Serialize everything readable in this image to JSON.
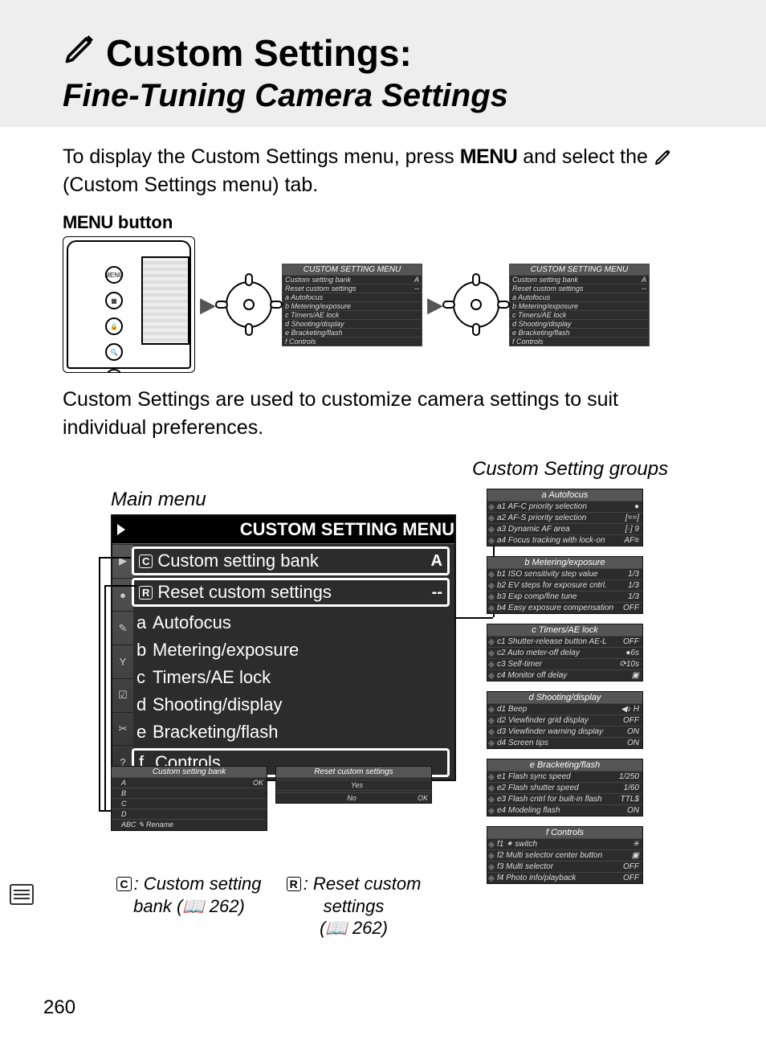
{
  "header": {
    "title_line1": "Custom Settings:",
    "title_line2": "Fine-Tuning Camera Settings"
  },
  "intro": {
    "pre": "To display the Custom Settings menu, press ",
    "menu_word": "MENU",
    "mid": " and select the ",
    "post": " (Custom Settings menu) tab."
  },
  "menu_button_caption": {
    "menu": "MENU",
    "button": " button"
  },
  "mini_menu_title": "CUSTOM SETTING MENU",
  "mini_menu_items": [
    {
      "l": "",
      "t": "Custom setting bank",
      "r": "A"
    },
    {
      "l": "",
      "t": "Reset custom settings",
      "r": "--"
    },
    {
      "l": "a",
      "t": "Autofocus",
      "r": ""
    },
    {
      "l": "b",
      "t": "Metering/exposure",
      "r": ""
    },
    {
      "l": "c",
      "t": "Timers/AE lock",
      "r": ""
    },
    {
      "l": "d",
      "t": "Shooting/display",
      "r": ""
    },
    {
      "l": "e",
      "t": "Bracketing/flash",
      "r": ""
    },
    {
      "l": "f",
      "t": "Controls",
      "r": ""
    }
  ],
  "para2": "Custom Settings are used to customize camera settings to suit individual preferences.",
  "labels": {
    "main_menu": "Main menu",
    "custom_setting_groups": "Custom Setting groups"
  },
  "main_lcd": {
    "title": "CUSTOM SETTING MENU",
    "items": [
      {
        "pre": "C",
        "letter": "",
        "text": "Custom setting bank",
        "rhs": "A",
        "boxed": true
      },
      {
        "pre": "R",
        "letter": "",
        "text": "Reset custom settings",
        "rhs": "--",
        "boxed": true
      },
      {
        "pre": "",
        "letter": "a",
        "text": "Autofocus",
        "rhs": "",
        "boxed": false
      },
      {
        "pre": "",
        "letter": "b",
        "text": "Metering/exposure",
        "rhs": "",
        "boxed": false
      },
      {
        "pre": "",
        "letter": "c",
        "text": "Timers/AE lock",
        "rhs": "",
        "boxed": false
      },
      {
        "pre": "",
        "letter": "d",
        "text": "Shooting/display",
        "rhs": "",
        "boxed": false
      },
      {
        "pre": "",
        "letter": "e",
        "text": "Bracketing/flash",
        "rhs": "",
        "boxed": false
      },
      {
        "pre": "",
        "letter": "f",
        "text": "Controls",
        "rhs": "",
        "boxed": true
      }
    ]
  },
  "sub_bank": {
    "title": "Custom setting bank",
    "rows": [
      {
        "l": "A",
        "r": "OK"
      },
      {
        "l": "B",
        "r": ""
      },
      {
        "l": "C",
        "r": ""
      },
      {
        "l": "D",
        "r": ""
      },
      {
        "l": "ABC ✎ Rename",
        "r": ""
      }
    ],
    "caption_pre": "C",
    "caption_main": ": Custom setting",
    "caption_line2": "bank (📖 262)"
  },
  "sub_reset": {
    "title": "Reset custom settings",
    "rows": [
      {
        "l": "",
        "r": ""
      },
      {
        "l": "Yes",
        "r": ""
      },
      {
        "l": "",
        "r": ""
      },
      {
        "l": "No",
        "r": "OK"
      }
    ],
    "caption_pre": "R",
    "caption_main": ": Reset custom",
    "caption_line2": "settings",
    "caption_line3": "(📖 262)"
  },
  "groups": [
    {
      "title": "a Autofocus",
      "rows": [
        {
          "l": "a1 AF-C priority selection",
          "r": "●"
        },
        {
          "l": "a2 AF-S priority selection",
          "r": "[==]"
        },
        {
          "l": "a3 Dynamic AF area",
          "r": "[·] 9"
        },
        {
          "l": "a4 Focus tracking with lock-on",
          "r": "AF≡"
        }
      ]
    },
    {
      "title": "b Metering/exposure",
      "rows": [
        {
          "l": "b1 ISO sensitivity step value",
          "r": "1/3"
        },
        {
          "l": "b2 EV steps for exposure cntrl.",
          "r": "1/3"
        },
        {
          "l": "b3 Exp comp/fine tune",
          "r": "1/3"
        },
        {
          "l": "b4 Easy exposure compensation",
          "r": "OFF"
        }
      ]
    },
    {
      "title": "c Timers/AE lock",
      "rows": [
        {
          "l": "c1 Shutter-release button AE-L",
          "r": "OFF"
        },
        {
          "l": "c2 Auto meter-off delay",
          "r": "●6s"
        },
        {
          "l": "c3 Self-timer",
          "r": "⟳10s"
        },
        {
          "l": "c4 Monitor off delay",
          "r": "▣"
        }
      ]
    },
    {
      "title": "d Shooting/display",
      "rows": [
        {
          "l": "d1 Beep",
          "r": "◀♪ H"
        },
        {
          "l": "d2 Viewfinder grid display",
          "r": "OFF"
        },
        {
          "l": "d3 Viewfinder warning display",
          "r": "ON"
        },
        {
          "l": "d4 Screen tips",
          "r": "ON"
        }
      ]
    },
    {
      "title": "e Bracketing/flash",
      "rows": [
        {
          "l": "e1 Flash sync speed",
          "r": "1/250"
        },
        {
          "l": "e2 Flash shutter speed",
          "r": "1/60"
        },
        {
          "l": "e3 Flash cntrl for built-in flash",
          "r": "TTL$"
        },
        {
          "l": "e4 Modeling flash",
          "r": "ON"
        }
      ]
    },
    {
      "title": "f Controls",
      "rows": [
        {
          "l": "f1 ⁕ switch",
          "r": "✳"
        },
        {
          "l": "f2 Multi selector center button",
          "r": "▣"
        },
        {
          "l": "f3 Multi selector",
          "r": "OFF"
        },
        {
          "l": "f4 Photo info/playback",
          "r": "OFF"
        }
      ]
    }
  ],
  "page_number": "260"
}
